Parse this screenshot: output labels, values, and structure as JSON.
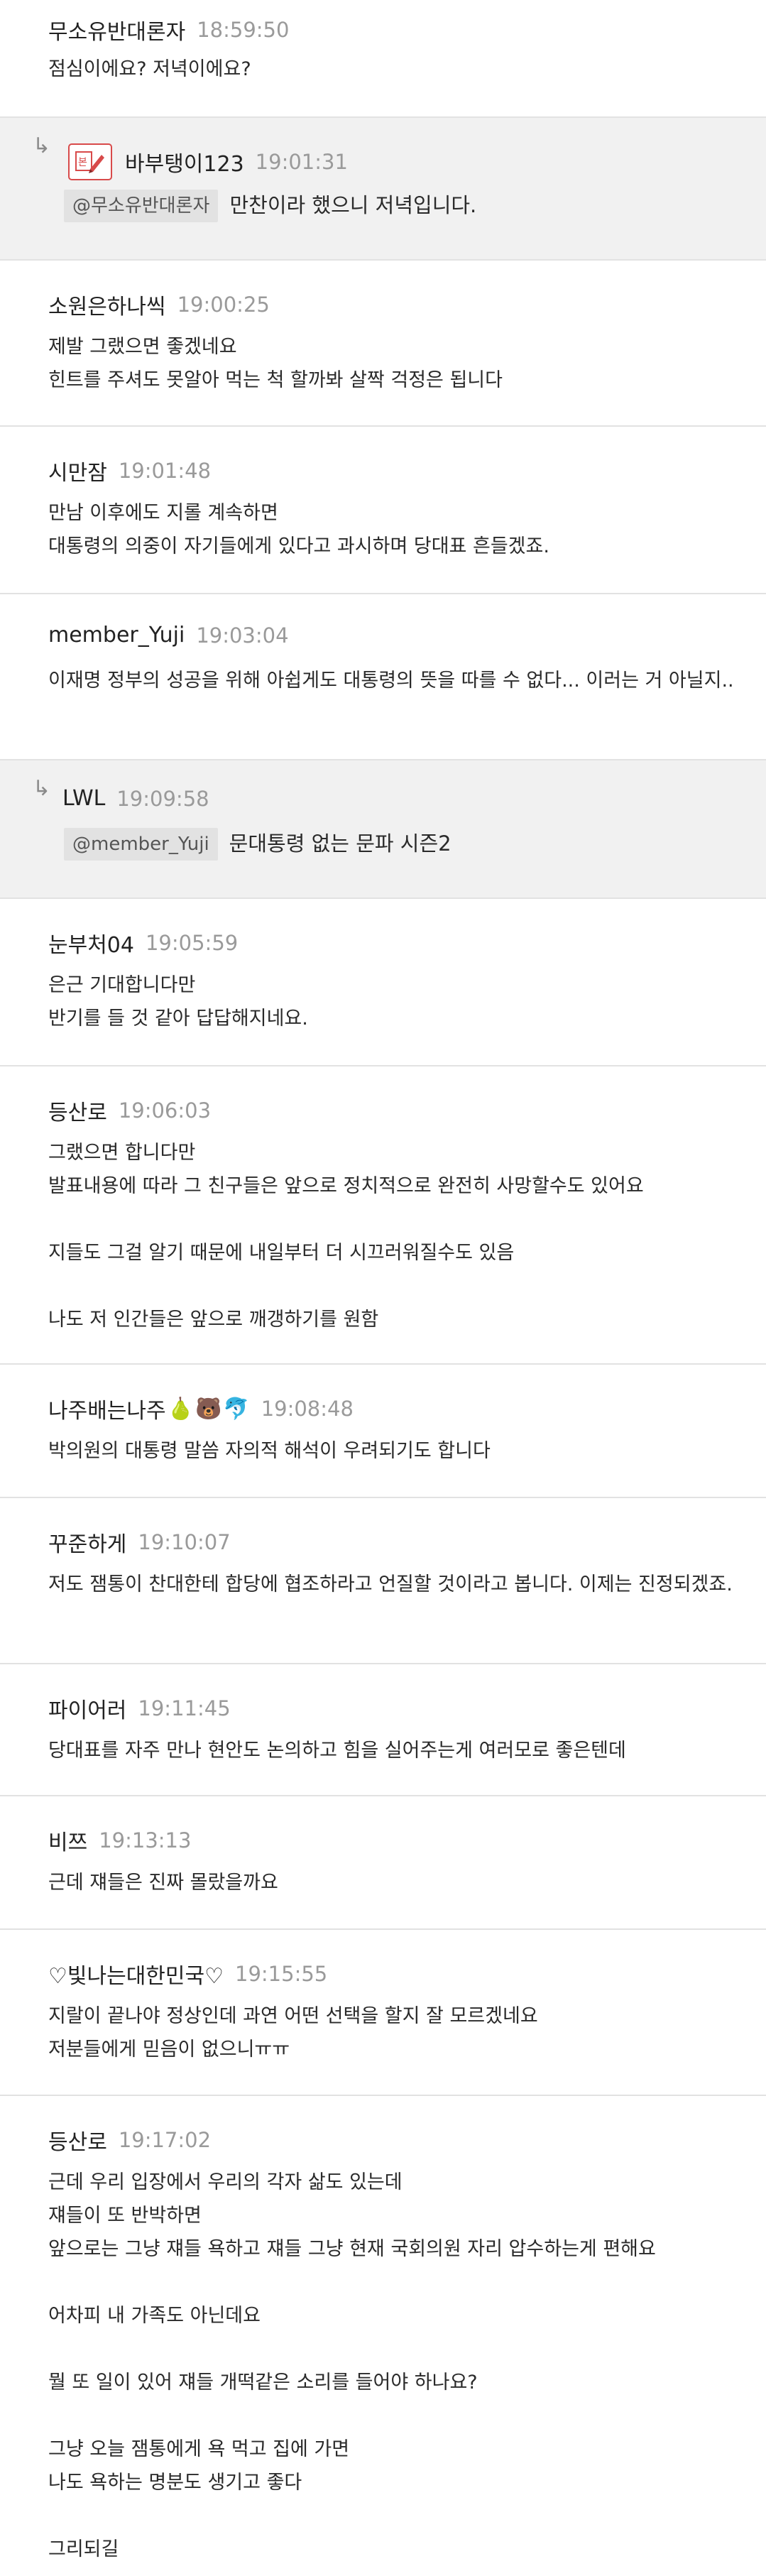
{
  "comments": [
    {
      "author": "무소유반대론자",
      "time": "18:59:50",
      "lines": [
        "점심이에요? 저녁이에요?"
      ]
    },
    {
      "author": "바부탱이123",
      "time": "19:01:31",
      "mention": "@무소유반대론자",
      "text": "만찬이라 했으니 저녁입니다.",
      "avatar": "avatar-badge-icon"
    },
    {
      "author": "소원은하나씩",
      "time": "19:00:25",
      "lines": [
        "제발 그랬으면 좋겠네요",
        "힌트를 주셔도 못알아 먹는 척 할까봐 살짝 걱정은 됩니다"
      ]
    },
    {
      "author": "시만잠",
      "time": "19:01:48",
      "lines": [
        "만남 이후에도 지롤 계속하면",
        "대통령의 의중이 자기들에게 있다고 과시하며 당대표 흔들겠죠."
      ]
    },
    {
      "author": "member_Yuji",
      "time": "19:03:04",
      "lines": [
        "이재명 정부의 성공을 위해 아쉽게도 대통령의 뜻을 따를 수 없다... 이러는 거 아닐지.."
      ]
    },
    {
      "author": "LWL",
      "time": "19:09:58",
      "mention": "@member_Yuji",
      "text": "문대통령 없는 문파 시즌2"
    },
    {
      "author": "눈부처04",
      "time": "19:05:59",
      "lines": [
        "은근 기대합니다만",
        "반기를 들 것 같아 답답해지네요."
      ]
    },
    {
      "author": "등산로",
      "time": "19:06:03",
      "lines": [
        "그랬으면 합니다만",
        "발표내용에 따라 그 친구들은 앞으로 정치적으로 완전히 사망할수도 있어요",
        "",
        "지들도 그걸 알기 때문에 내일부터 더 시끄러워질수도 있음",
        "",
        "나도 저 인간들은 앞으로 깨갱하기를 원함"
      ]
    },
    {
      "author": "나주배는나주",
      "time": "19:08:48",
      "emojis": [
        "🍐",
        "🐻",
        "🐬"
      ],
      "lines": [
        "박의원의 대통령 말씀 자의적 해석이 우려되기도 합니다"
      ]
    },
    {
      "author": "꾸준하게",
      "time": "19:10:07",
      "lines": [
        "저도 잼통이 찬대한테 합당에 협조하라고 언질할 것이라고 봅니다. 이제는 진정되겠죠."
      ]
    },
    {
      "author": "파이어러",
      "time": "19:11:45",
      "lines": [
        "당대표를 자주 만나 현안도 논의하고 힘을 실어주는게 여러모로 좋은텐데"
      ]
    },
    {
      "author": "비쯔",
      "time": "19:13:13",
      "lines": [
        "근데 쟤들은 진짜 몰랐을까요"
      ]
    },
    {
      "author": "♡빛나는대한민국♡",
      "time": "19:15:55",
      "lines": [
        "지랄이 끝나야 정상인데 과연 어떤 선택을 할지 잘 모르겠네요",
        "저분들에게 믿음이 없으니ㅠㅠ"
      ]
    },
    {
      "author": "등산로",
      "time": "19:17:02",
      "lines": [
        "근데 우리 입장에서 우리의 각자 삶도 있는데",
        "쟤들이 또 반박하면",
        "앞으로는 그냥 쟤들 욕하고 쟤들 그냥 현재 국회의원 자리 압수하는게 편해요",
        "",
        "어차피 내 가족도 아닌데요",
        "",
        "뭘 또 일이 있어 쟤들 개떡같은 소리를 들어야 하나요?",
        "",
        "그냥 오늘 잼통에게 욕 먹고 집에 가면",
        "나도 욕하는 명분도 생기고 좋다",
        "",
        "그리되길"
      ]
    }
  ]
}
